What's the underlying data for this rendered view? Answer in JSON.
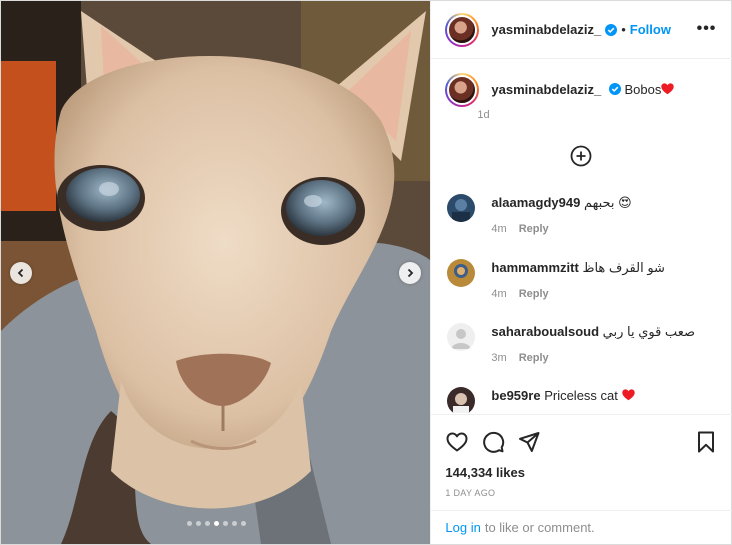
{
  "post": {
    "username": "yasminabdelaziz_",
    "follow_label": "Follow",
    "separator": "•",
    "more_label": "•••",
    "caption": {
      "username": "yasminabdelaziz_",
      "text": "Bobos",
      "time": "1d"
    },
    "carousel": {
      "dot_count": 7,
      "active_index": 3
    },
    "comments": [
      {
        "username": "alaamagdy949",
        "text": "بحبهم 😍",
        "time": "4m",
        "reply_label": "Reply"
      },
      {
        "username": "hammammzitt",
        "text": "شو القرف هاظ",
        "time": "4m",
        "reply_label": "Reply"
      },
      {
        "username": "saharaboualsoud",
        "text": "صعب قوي يا ربي",
        "time": "3m",
        "reply_label": "Reply"
      },
      {
        "username": "be959re",
        "text": "Priceless cat",
        "time": "",
        "reply_label": ""
      }
    ],
    "likes": "144,334 likes",
    "date": "1 DAY AGO",
    "login": {
      "link": "Log in",
      "rest": "to like or comment."
    }
  },
  "colors": {
    "accent": "#0095f6",
    "heart": "#ed1c24",
    "muted": "#8e8e8e",
    "text": "#262626"
  },
  "icons": {
    "verified": "verified-badge-icon",
    "heart_caption": "red-heart-icon",
    "load_more": "plus-circle-icon",
    "like": "heart-outline-icon",
    "comment": "comment-bubble-icon",
    "share": "paper-plane-icon",
    "save": "bookmark-icon",
    "prev": "chevron-left-icon",
    "next": "chevron-right-icon"
  }
}
